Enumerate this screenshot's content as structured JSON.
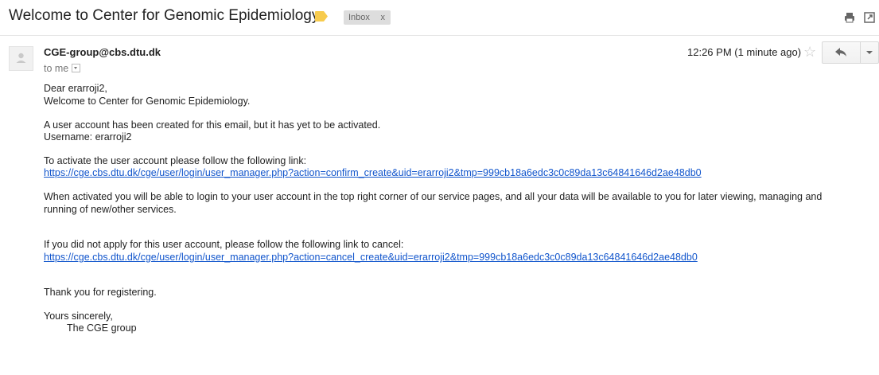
{
  "header": {
    "subject": "Welcome to Center for Genomic Epidemiology",
    "label_chip": "Inbox",
    "label_chip_close": "x",
    "label_color": "#f7cb4d",
    "icons": [
      "print-icon",
      "new-window-icon"
    ]
  },
  "message": {
    "sender": "CGE-group@cbs.dtu.dk",
    "recipient": "to me",
    "timestamp": "12:26 PM (1 minute ago)",
    "icons": [
      "avatar-icon",
      "star-icon",
      "reply-icon",
      "more-options-icon"
    ]
  },
  "body": {
    "greeting": "Dear erarroji2,",
    "welcome": "Welcome to Center for Genomic Epidemiology.",
    "account_created": "A user account has been created for this email, but it has yet to be activated.",
    "username": "Username: erarroji2",
    "activate_intro": "To activate the user account please follow the following link:",
    "activate_link": "https://cge.cbs.dtu.dk/cge/user/login/user_manager.php?action=confirm_create&uid=erarroji2&tmp=999cb18a6edc3c0c89da13c64841646d2ae48db0",
    "when_activated_1": "When activated you will be able to login to your user account in the top right corner of our service pages, and all your data will be available to you for later viewing, managing and",
    "when_activated_2": "running of new/other services.",
    "cancel_intro": "If you did not apply for this user account, please follow the following link to cancel:",
    "cancel_link": "https://cge.cbs.dtu.dk/cge/user/login/user_manager.php?action=cancel_create&uid=erarroji2&tmp=999cb18a6edc3c0c89da13c64841646d2ae48db0",
    "thanks": "Thank you for registering.",
    "closing": "Yours sincerely,",
    "signature": "The CGE group"
  },
  "colors": {
    "link": "#1155cc",
    "text": "#222222",
    "muted": "#777777"
  }
}
